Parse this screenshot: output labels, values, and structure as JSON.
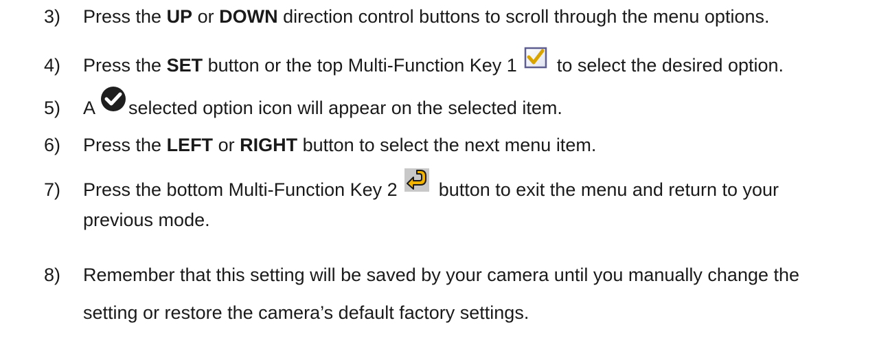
{
  "steps": [
    {
      "num": "3)",
      "parts": [
        "Press the ",
        "UP",
        " or ",
        "DOWN",
        " direction control buttons to scroll through the menu options."
      ]
    },
    {
      "num": "4)",
      "parts": [
        "Press the ",
        "SET",
        " button or the top Multi-Function Key 1",
        "to select the desired option."
      ],
      "icon": "checkbox-checked-icon"
    },
    {
      "num": "5)",
      "parts": [
        "A",
        "selected option icon will appear on the selected item."
      ],
      "icon": "selected-check-circle-icon"
    },
    {
      "num": "6)",
      "parts": [
        "Press the ",
        "LEFT",
        " or ",
        "RIGHT",
        " button to select the next menu item."
      ]
    },
    {
      "num": "7)",
      "parts": [
        "Press the bottom Multi-Function Key 2",
        "button to exit the menu and return to your",
        "previous mode."
      ],
      "icon": "return-arrow-icon"
    },
    {
      "num": "8)",
      "parts": [
        "Remember that this setting will be saved by your camera until you manually change the",
        "setting or restore the camera’s default factory settings."
      ]
    }
  ],
  "colors": {
    "text": "#1a1a1a",
    "checkbox_border": "#6b6b9b",
    "checkbox_check": "#e0b000",
    "return_arrow": "#f2b400"
  }
}
